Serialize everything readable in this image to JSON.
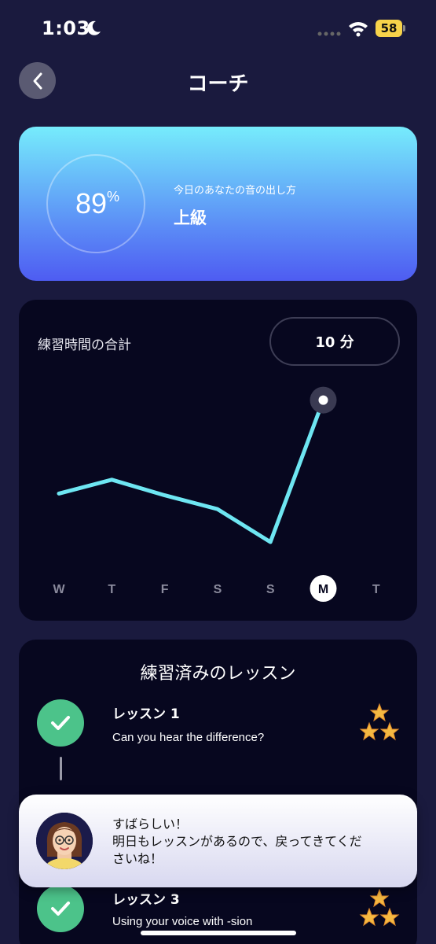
{
  "status_bar": {
    "time": "1:03",
    "battery": "58"
  },
  "header": {
    "title": "コーチ"
  },
  "level_card": {
    "score": "89",
    "score_unit": "%",
    "subtitle": "今日のあなたの音の出し方",
    "level": "上級"
  },
  "practice": {
    "title": "練習時間の合計",
    "total": "10 分"
  },
  "chart_data": {
    "type": "line",
    "categories": [
      "W",
      "T",
      "F",
      "S",
      "S",
      "M",
      "T"
    ],
    "values": [
      3.8,
      4.6,
      null,
      2.9,
      1.0,
      9.2,
      null
    ],
    "interpolated_values": [
      3.8,
      4.6,
      3.7,
      2.9,
      1.0,
      9.2
    ],
    "highlighted_category_index": 5,
    "ylim": [
      0,
      10
    ],
    "line_color": "#6ee6f2",
    "title": "",
    "xlabel": "",
    "ylabel": ""
  },
  "lessons": {
    "title": "練習済みのレッスン",
    "items": [
      {
        "name": "レッスン 1",
        "description": "Can you hear the difference?",
        "stars": 3
      },
      {
        "name": "レッスン 3",
        "description": "Using your voice with -sion",
        "stars": 3
      }
    ]
  },
  "coach_toast": {
    "line1": "すばらしい！",
    "line2": "明日もレッスンがあるので、戻ってきてくだ",
    "line3": "さいね！"
  },
  "colors": {
    "background": "#1a1a3e",
    "card": "#07071f",
    "accent_line": "#6ee6f2",
    "check_green": "#4cc38a",
    "star": "#f5b942"
  }
}
